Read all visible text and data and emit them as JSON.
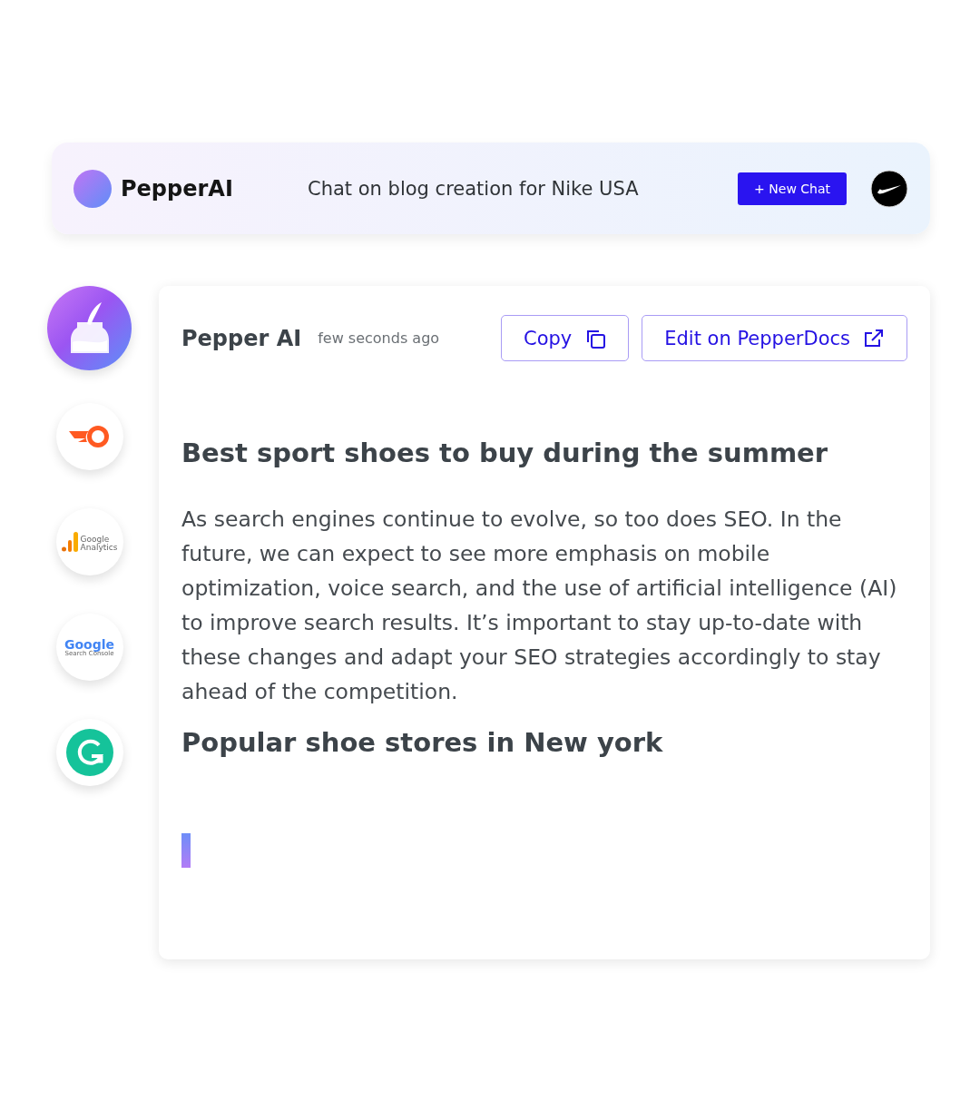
{
  "header": {
    "brand": "PepperAI",
    "chat_title": "Chat on blog creation for Nike USA",
    "new_chat_button": "+ New Chat"
  },
  "integrations": [
    {
      "kind": "quill"
    },
    {
      "kind": "semrush"
    },
    {
      "kind": "analytics",
      "logo_lines": [
        "Google",
        "Analytics"
      ]
    },
    {
      "kind": "search_console",
      "logo_lines": [
        "Google",
        "Search Console"
      ]
    },
    {
      "kind": "grammarly"
    }
  ],
  "message": {
    "author": "Pepper AI",
    "time": "few seconds ago",
    "buttons": [
      {
        "label": "Copy",
        "kind": "copy"
      },
      {
        "label": "Edit on PepperDocs",
        "kind": "external"
      }
    ],
    "blocks": [
      {
        "kind": "heading",
        "text": "Best sport shoes to buy during the summer"
      },
      {
        "kind": "paragraph",
        "text": "As search engines continue to evolve, so too does SEO. In the future, we can expect to see more emphasis on mobile optimization, voice search, and the use of artificial intelligence (AI) to improve search results. It’s important to stay up-to-date with these changes and adapt your SEO strategies accordingly to stay ahead of the competition."
      },
      {
        "kind": "heading",
        "text": "Popular shoe stores in New york"
      }
    ]
  }
}
